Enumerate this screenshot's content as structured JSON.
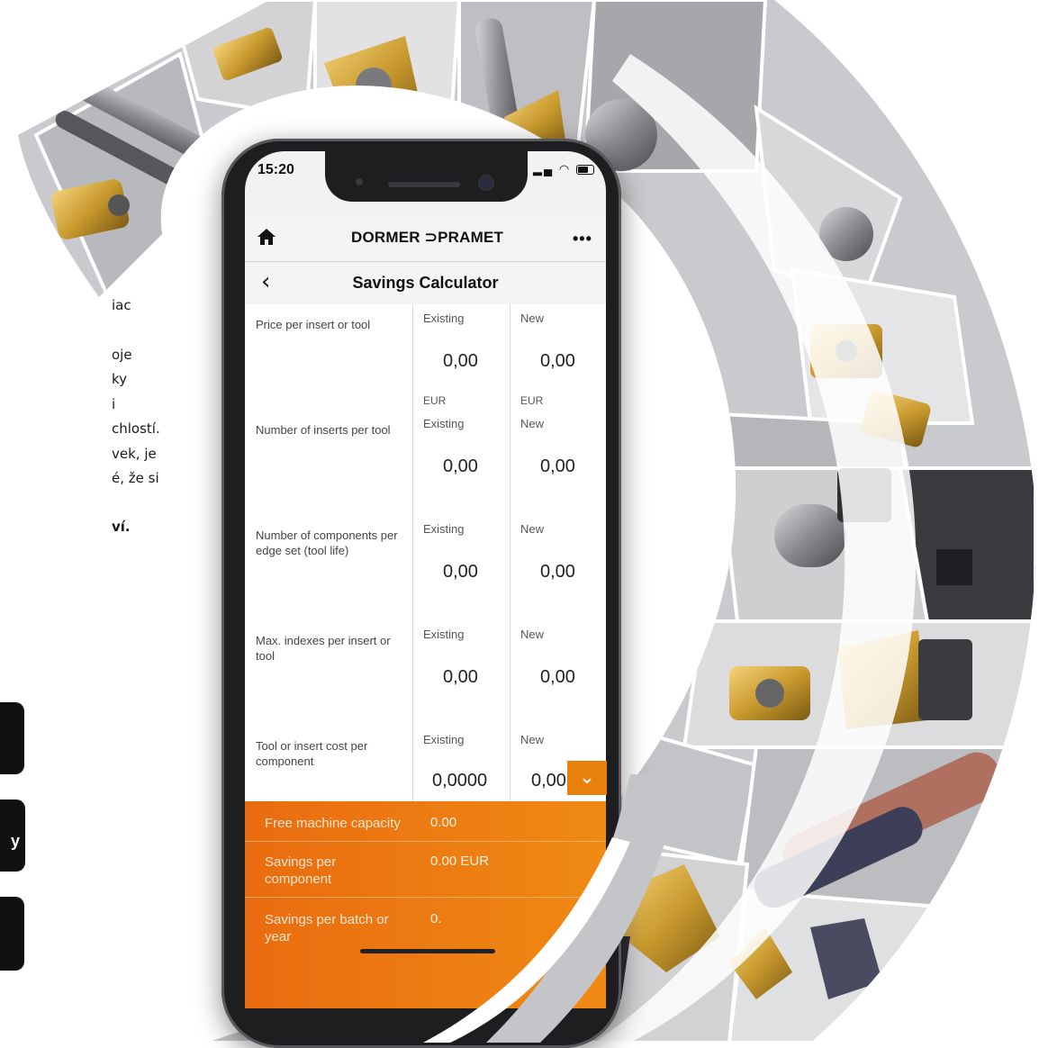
{
  "left_text": {
    "line1": "iac",
    "line2": "oje",
    "line3": "ky",
    "line4": "i",
    "line5": "chlostí.",
    "line6": "vek, je",
    "line7": "é, že si",
    "line8": "ví.",
    "btn2_glyph": "y"
  },
  "status_bar": {
    "time": "15:20"
  },
  "header": {
    "logo": "DORMER ⊃PRAMET"
  },
  "nav": {
    "title": "Savings Calculator"
  },
  "rows": [
    {
      "label": "Price per insert or tool",
      "existing_label": "Existing",
      "new_label": "New",
      "existing_value": "0,00",
      "new_value": "0,00",
      "existing_unit": "EUR",
      "new_unit": "EUR"
    },
    {
      "label": "Number of inserts per tool",
      "existing_label": "Existing",
      "new_label": "New",
      "existing_value": "0,00",
      "new_value": "0,00"
    },
    {
      "label": "Number of components per edge set (tool life)",
      "existing_label": "Existing",
      "new_label": "New",
      "existing_value": "0,00",
      "new_value": "0,00"
    },
    {
      "label": "Max. indexes per insert or tool",
      "existing_label": "Existing",
      "new_label": "New",
      "existing_value": "0,00",
      "new_value": "0,00"
    },
    {
      "label": "Tool or insert cost per component",
      "existing_label": "Existing",
      "new_label": "New",
      "existing_value": "0,0000",
      "new_value": "0,00"
    }
  ],
  "results": {
    "free_capacity_label": "Free machine capacity",
    "free_capacity_value": "0.00",
    "savings_component_label": "Savings per component",
    "savings_component_value": "0.00 EUR",
    "savings_batch_label": "Savings per batch or year",
    "savings_batch_value": "0."
  },
  "colors": {
    "accent": "#e8800c",
    "header_bg": "#f4f4f4"
  },
  "icons": {
    "home": "home-icon",
    "more": "more-icon",
    "back": "chevron-left-icon",
    "dropdown": "chevron-down-icon"
  }
}
